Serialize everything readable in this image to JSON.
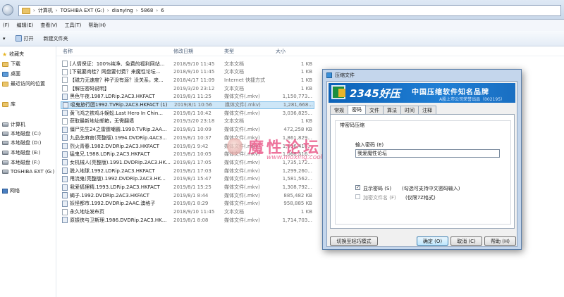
{
  "address": {
    "segments": [
      "计算机",
      "TOSHIBA EXT (G:)",
      "dianying",
      "5868",
      "6"
    ]
  },
  "menubar": [
    "(F)",
    "编辑(E)",
    "查看(V)",
    "工具(T)",
    "帮助(H)"
  ],
  "toolbar": {
    "organize": "▾",
    "open": "打开",
    "new_folder": "新建文件夹"
  },
  "nav": {
    "favorites": "收藏夹",
    "downloads": "下载",
    "desktop": "桌面",
    "recent": "最近访问的位置",
    "library": "库",
    "computer": "计算机",
    "drive_c": "本地磁盘 (C:)",
    "drive_d": "本地磁盘 (D:)",
    "drive_e": "本地磁盘 (E:)",
    "drive_f": "本地磁盘 (F:)",
    "drive_g": "TOSHIBA EXT (G:)",
    "network": "网络"
  },
  "columns": {
    "name": "名称",
    "date": "修改日期",
    "type": "类型",
    "size": "大小"
  },
  "files": [
    {
      "name": "[人情保证：100%纯净、免费的福利网站...",
      "date": "2018/9/10 11:45",
      "type": "文本文档",
      "size": "1 KB",
      "video": false
    },
    {
      "name": "[下载要肉桂？网盘要付费？来魔性论坛...",
      "date": "2018/9/10 11:45",
      "type": "文本文档",
      "size": "1 KB",
      "video": false
    },
    {
      "name": "【磁力无速度？种子没有源？没关系，来...",
      "date": "2018/4/17 11:09",
      "type": "Internet 快捷方式",
      "size": "1 KB",
      "video": false
    },
    {
      "name": "【解压密码说明】",
      "date": "2019/3/20 23:12",
      "type": "文本文档",
      "size": "1 KB",
      "video": false
    },
    {
      "name": "黑色午夜.1987.LDRip.2AC3.HKFACT",
      "date": "2019/8/1 11:25",
      "type": "媒体文件(.mkv)",
      "size": "1,150,773...",
      "video": true
    },
    {
      "name": "吸鬼旅行团1992.TVRip.2AC3.HKFACT (1)",
      "date": "2019/8/1 10:56",
      "type": "媒体文件(.mkv)",
      "size": "1,281,668...",
      "video": true,
      "selected": true
    },
    {
      "name": "黄飞鸿之铁鸡斗蜈蚣.Last Hero In Chin...",
      "date": "2019/8/1 10:42",
      "type": "媒体文件(.mkv)",
      "size": "3,036,825...",
      "video": true
    },
    {
      "name": "获取最新地址邮箱，无需翻墙",
      "date": "2019/3/20 23:18",
      "type": "文本文档",
      "size": "1 KB",
      "video": false
    },
    {
      "name": "僵尸先生24之雷霆嘲霸.1990.TVRip.2AA...",
      "date": "2019/8/1 10:09",
      "type": "媒体文件(.mkv)",
      "size": "472,258 KB",
      "video": true
    },
    {
      "name": "九品芝麻官(亮整版).1994.DVDRip.4AC3...",
      "date": "2019/8/1 10:37",
      "type": "媒体文件(.mkv)",
      "size": "1,861,829...",
      "video": true
    },
    {
      "name": "烈火青春.1982.DVDRip.2AC3.HKFACT",
      "date": "2019/8/1 9:42",
      "type": "媒体文件(.mkv)",
      "size": "1,616,416...",
      "video": true
    },
    {
      "name": "猛鬼兄.1988.LDRip.2AC3.HKFACT",
      "date": "2019/8/1 10:05",
      "type": "媒体文件(.mkv)",
      "size": "1,068,516...",
      "video": true
    },
    {
      "name": "女机械人(亮整版).1991.DVDRip.2AC3.HK...",
      "date": "2019/8/1 17:05",
      "type": "媒体文件(.mkv)",
      "size": "1,735,172...",
      "video": true
    },
    {
      "name": "脱入地球.1992.LDRip.2AC3.HKFACT",
      "date": "2019/8/1 17:03",
      "type": "媒体文件(.mkv)",
      "size": "1,299,260...",
      "video": true
    },
    {
      "name": "甩流鬼(亮整版).1992.DVDRip.2AC3.HK...",
      "date": "2019/8/1 15:47",
      "type": "媒体文件(.mkv)",
      "size": "1,581,562...",
      "video": true
    },
    {
      "name": "我爱狐狸精.1993.LDRip.2AC3.HKFACT",
      "date": "2019/8/1 15:25",
      "type": "媒体文件(.mkv)",
      "size": "1,308,792...",
      "video": true
    },
    {
      "name": "蝎子.1992.DVDRip.2AC3.HKFACT",
      "date": "2019/8/1 8:44",
      "type": "媒体文件(.mkv)",
      "size": "885,482 KB",
      "video": true
    },
    {
      "name": "妖怪都市.1992.DVDRip.2AAC.澳格子",
      "date": "2019/8/1 8:29",
      "type": "媒体文件(.mkv)",
      "size": "958,885 KB",
      "video": true
    },
    {
      "name": "永久地址发布页",
      "date": "2018/9/10 11:45",
      "type": "文本文档",
      "size": "1 KB",
      "video": false
    },
    {
      "name": "原振侠与卫斯理.1986.DVDRip.2AC3.HK...",
      "date": "2019/8/1 8:08",
      "type": "媒体文件(.mkv)",
      "size": "1,714,703...",
      "video": true
    }
  ],
  "dialog": {
    "title": "压缩文件",
    "brand": "2345好压",
    "slogan": "中国压缩软件知名品牌",
    "subtag": "A股上市公司荣誉出品（002195）",
    "tabs": [
      "常规",
      "密码",
      "文件",
      "算法",
      "时间",
      "注释"
    ],
    "group_title": "带密码压缩",
    "password_label": "输入密码 (E)",
    "password_value": "我爱魔性论坛",
    "show_password": "显示密码 (S)",
    "show_password_hint": "(勾选可支持中文密码输入)",
    "encrypt_names": "加密文件名 (F)",
    "encrypt_names_hint": "(仅限7Z格式)",
    "switch_mode": "切换至轻巧模式",
    "ok": "确定 (O)",
    "cancel": "取消 (C)",
    "help": "帮助 (H)"
  },
  "watermark": {
    "text": "魔性论坛",
    "url": "www.moxing.cool"
  }
}
